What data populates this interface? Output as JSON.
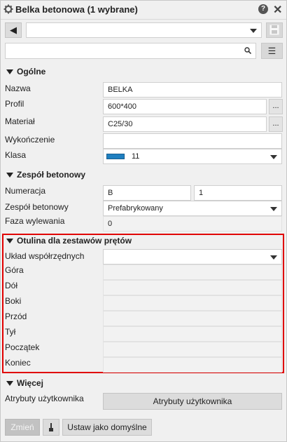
{
  "window": {
    "title": "Belka betonowa (1 wybrane)",
    "icons": {
      "settings": "gear-icon",
      "help": "help-icon",
      "close": "close-icon"
    },
    "help_glyph": "?",
    "close_glyph": "✕"
  },
  "toolbar": {
    "back_glyph": "◀",
    "preset_value": "",
    "search_placeholder": "",
    "menu_glyph": "☰"
  },
  "sections": {
    "general": {
      "header": "Ogólne",
      "name_label": "Nazwa",
      "name_value": "BELKA",
      "profile_label": "Profil",
      "profile_value": "600*400",
      "material_label": "Materiał",
      "material_value": "C25/30",
      "finish_label": "Wykończenie",
      "finish_value": "",
      "class_label": "Klasa",
      "class_value": "11",
      "class_color": "#1f7fc0",
      "browse_glyph": "..."
    },
    "cast_unit": {
      "header": "Zespół betonowy",
      "numbering_label": "Numeracja",
      "numbering_prefix": "B",
      "numbering_start": "1",
      "cast_unit_label": "Zespół betonowy",
      "cast_unit_value": "Prefabrykowany",
      "pour_phase_label": "Faza wylewania",
      "pour_phase_value": "0"
    },
    "rebar_cover": {
      "header": "Otulina dla zestawów prętów",
      "coord_system_label": "Układ współrzędnych",
      "coord_system_value": "",
      "top_label": "Góra",
      "bottom_label": "Dół",
      "sides_label": "Boki",
      "front_label": "Przód",
      "back_label": "Tył",
      "start_label": "Początek",
      "end_label": "Koniec"
    },
    "more": {
      "header": "Więcej",
      "user_attributes_label": "Atrybuty użytkownika",
      "user_attributes_button": "Atrybuty użytkownika"
    }
  },
  "footer": {
    "modify_button": "Zmień",
    "pick_icon": "brush-icon",
    "set_default_button": "Ustaw jako domyślne"
  },
  "colors": {
    "highlight_frame": "#e00000"
  }
}
